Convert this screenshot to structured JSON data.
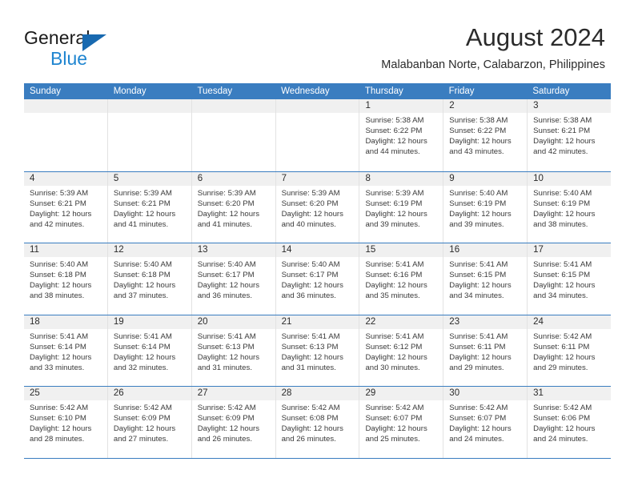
{
  "brand": {
    "name_top": "General",
    "name_bottom": "Blue",
    "logo_icon": "triangle-logo-icon",
    "accent_color": "#1f85d0",
    "triangle_color": "#1869b0"
  },
  "header": {
    "month_title": "August 2024",
    "location": "Malabanban Norte, Calabarzon, Philippines"
  },
  "calendar": {
    "header_background": "#3a7dc0",
    "weekdays": [
      "Sunday",
      "Monday",
      "Tuesday",
      "Wednesday",
      "Thursday",
      "Friday",
      "Saturday"
    ],
    "labels": {
      "sunrise": "Sunrise:",
      "sunset": "Sunset:",
      "daylight": "Daylight:"
    },
    "weeks": [
      [
        {
          "day": "",
          "empty": true
        },
        {
          "day": "",
          "empty": true
        },
        {
          "day": "",
          "empty": true
        },
        {
          "day": "",
          "empty": true
        },
        {
          "day": "1",
          "sunrise": "Sunrise: 5:38 AM",
          "sunset": "Sunset: 6:22 PM",
          "daylight_1": "Daylight: 12 hours",
          "daylight_2": "and 44 minutes."
        },
        {
          "day": "2",
          "sunrise": "Sunrise: 5:38 AM",
          "sunset": "Sunset: 6:22 PM",
          "daylight_1": "Daylight: 12 hours",
          "daylight_2": "and 43 minutes."
        },
        {
          "day": "3",
          "sunrise": "Sunrise: 5:38 AM",
          "sunset": "Sunset: 6:21 PM",
          "daylight_1": "Daylight: 12 hours",
          "daylight_2": "and 42 minutes."
        }
      ],
      [
        {
          "day": "4",
          "sunrise": "Sunrise: 5:39 AM",
          "sunset": "Sunset: 6:21 PM",
          "daylight_1": "Daylight: 12 hours",
          "daylight_2": "and 42 minutes."
        },
        {
          "day": "5",
          "sunrise": "Sunrise: 5:39 AM",
          "sunset": "Sunset: 6:21 PM",
          "daylight_1": "Daylight: 12 hours",
          "daylight_2": "and 41 minutes."
        },
        {
          "day": "6",
          "sunrise": "Sunrise: 5:39 AM",
          "sunset": "Sunset: 6:20 PM",
          "daylight_1": "Daylight: 12 hours",
          "daylight_2": "and 41 minutes."
        },
        {
          "day": "7",
          "sunrise": "Sunrise: 5:39 AM",
          "sunset": "Sunset: 6:20 PM",
          "daylight_1": "Daylight: 12 hours",
          "daylight_2": "and 40 minutes."
        },
        {
          "day": "8",
          "sunrise": "Sunrise: 5:39 AM",
          "sunset": "Sunset: 6:19 PM",
          "daylight_1": "Daylight: 12 hours",
          "daylight_2": "and 39 minutes."
        },
        {
          "day": "9",
          "sunrise": "Sunrise: 5:40 AM",
          "sunset": "Sunset: 6:19 PM",
          "daylight_1": "Daylight: 12 hours",
          "daylight_2": "and 39 minutes."
        },
        {
          "day": "10",
          "sunrise": "Sunrise: 5:40 AM",
          "sunset": "Sunset: 6:19 PM",
          "daylight_1": "Daylight: 12 hours",
          "daylight_2": "and 38 minutes."
        }
      ],
      [
        {
          "day": "11",
          "sunrise": "Sunrise: 5:40 AM",
          "sunset": "Sunset: 6:18 PM",
          "daylight_1": "Daylight: 12 hours",
          "daylight_2": "and 38 minutes."
        },
        {
          "day": "12",
          "sunrise": "Sunrise: 5:40 AM",
          "sunset": "Sunset: 6:18 PM",
          "daylight_1": "Daylight: 12 hours",
          "daylight_2": "and 37 minutes."
        },
        {
          "day": "13",
          "sunrise": "Sunrise: 5:40 AM",
          "sunset": "Sunset: 6:17 PM",
          "daylight_1": "Daylight: 12 hours",
          "daylight_2": "and 36 minutes."
        },
        {
          "day": "14",
          "sunrise": "Sunrise: 5:40 AM",
          "sunset": "Sunset: 6:17 PM",
          "daylight_1": "Daylight: 12 hours",
          "daylight_2": "and 36 minutes."
        },
        {
          "day": "15",
          "sunrise": "Sunrise: 5:41 AM",
          "sunset": "Sunset: 6:16 PM",
          "daylight_1": "Daylight: 12 hours",
          "daylight_2": "and 35 minutes."
        },
        {
          "day": "16",
          "sunrise": "Sunrise: 5:41 AM",
          "sunset": "Sunset: 6:15 PM",
          "daylight_1": "Daylight: 12 hours",
          "daylight_2": "and 34 minutes."
        },
        {
          "day": "17",
          "sunrise": "Sunrise: 5:41 AM",
          "sunset": "Sunset: 6:15 PM",
          "daylight_1": "Daylight: 12 hours",
          "daylight_2": "and 34 minutes."
        }
      ],
      [
        {
          "day": "18",
          "sunrise": "Sunrise: 5:41 AM",
          "sunset": "Sunset: 6:14 PM",
          "daylight_1": "Daylight: 12 hours",
          "daylight_2": "and 33 minutes."
        },
        {
          "day": "19",
          "sunrise": "Sunrise: 5:41 AM",
          "sunset": "Sunset: 6:14 PM",
          "daylight_1": "Daylight: 12 hours",
          "daylight_2": "and 32 minutes."
        },
        {
          "day": "20",
          "sunrise": "Sunrise: 5:41 AM",
          "sunset": "Sunset: 6:13 PM",
          "daylight_1": "Daylight: 12 hours",
          "daylight_2": "and 31 minutes."
        },
        {
          "day": "21",
          "sunrise": "Sunrise: 5:41 AM",
          "sunset": "Sunset: 6:13 PM",
          "daylight_1": "Daylight: 12 hours",
          "daylight_2": "and 31 minutes."
        },
        {
          "day": "22",
          "sunrise": "Sunrise: 5:41 AM",
          "sunset": "Sunset: 6:12 PM",
          "daylight_1": "Daylight: 12 hours",
          "daylight_2": "and 30 minutes."
        },
        {
          "day": "23",
          "sunrise": "Sunrise: 5:41 AM",
          "sunset": "Sunset: 6:11 PM",
          "daylight_1": "Daylight: 12 hours",
          "daylight_2": "and 29 minutes."
        },
        {
          "day": "24",
          "sunrise": "Sunrise: 5:42 AM",
          "sunset": "Sunset: 6:11 PM",
          "daylight_1": "Daylight: 12 hours",
          "daylight_2": "and 29 minutes."
        }
      ],
      [
        {
          "day": "25",
          "sunrise": "Sunrise: 5:42 AM",
          "sunset": "Sunset: 6:10 PM",
          "daylight_1": "Daylight: 12 hours",
          "daylight_2": "and 28 minutes."
        },
        {
          "day": "26",
          "sunrise": "Sunrise: 5:42 AM",
          "sunset": "Sunset: 6:09 PM",
          "daylight_1": "Daylight: 12 hours",
          "daylight_2": "and 27 minutes."
        },
        {
          "day": "27",
          "sunrise": "Sunrise: 5:42 AM",
          "sunset": "Sunset: 6:09 PM",
          "daylight_1": "Daylight: 12 hours",
          "daylight_2": "and 26 minutes."
        },
        {
          "day": "28",
          "sunrise": "Sunrise: 5:42 AM",
          "sunset": "Sunset: 6:08 PM",
          "daylight_1": "Daylight: 12 hours",
          "daylight_2": "and 26 minutes."
        },
        {
          "day": "29",
          "sunrise": "Sunrise: 5:42 AM",
          "sunset": "Sunset: 6:07 PM",
          "daylight_1": "Daylight: 12 hours",
          "daylight_2": "and 25 minutes."
        },
        {
          "day": "30",
          "sunrise": "Sunrise: 5:42 AM",
          "sunset": "Sunset: 6:07 PM",
          "daylight_1": "Daylight: 12 hours",
          "daylight_2": "and 24 minutes."
        },
        {
          "day": "31",
          "sunrise": "Sunrise: 5:42 AM",
          "sunset": "Sunset: 6:06 PM",
          "daylight_1": "Daylight: 12 hours",
          "daylight_2": "and 24 minutes."
        }
      ]
    ]
  }
}
